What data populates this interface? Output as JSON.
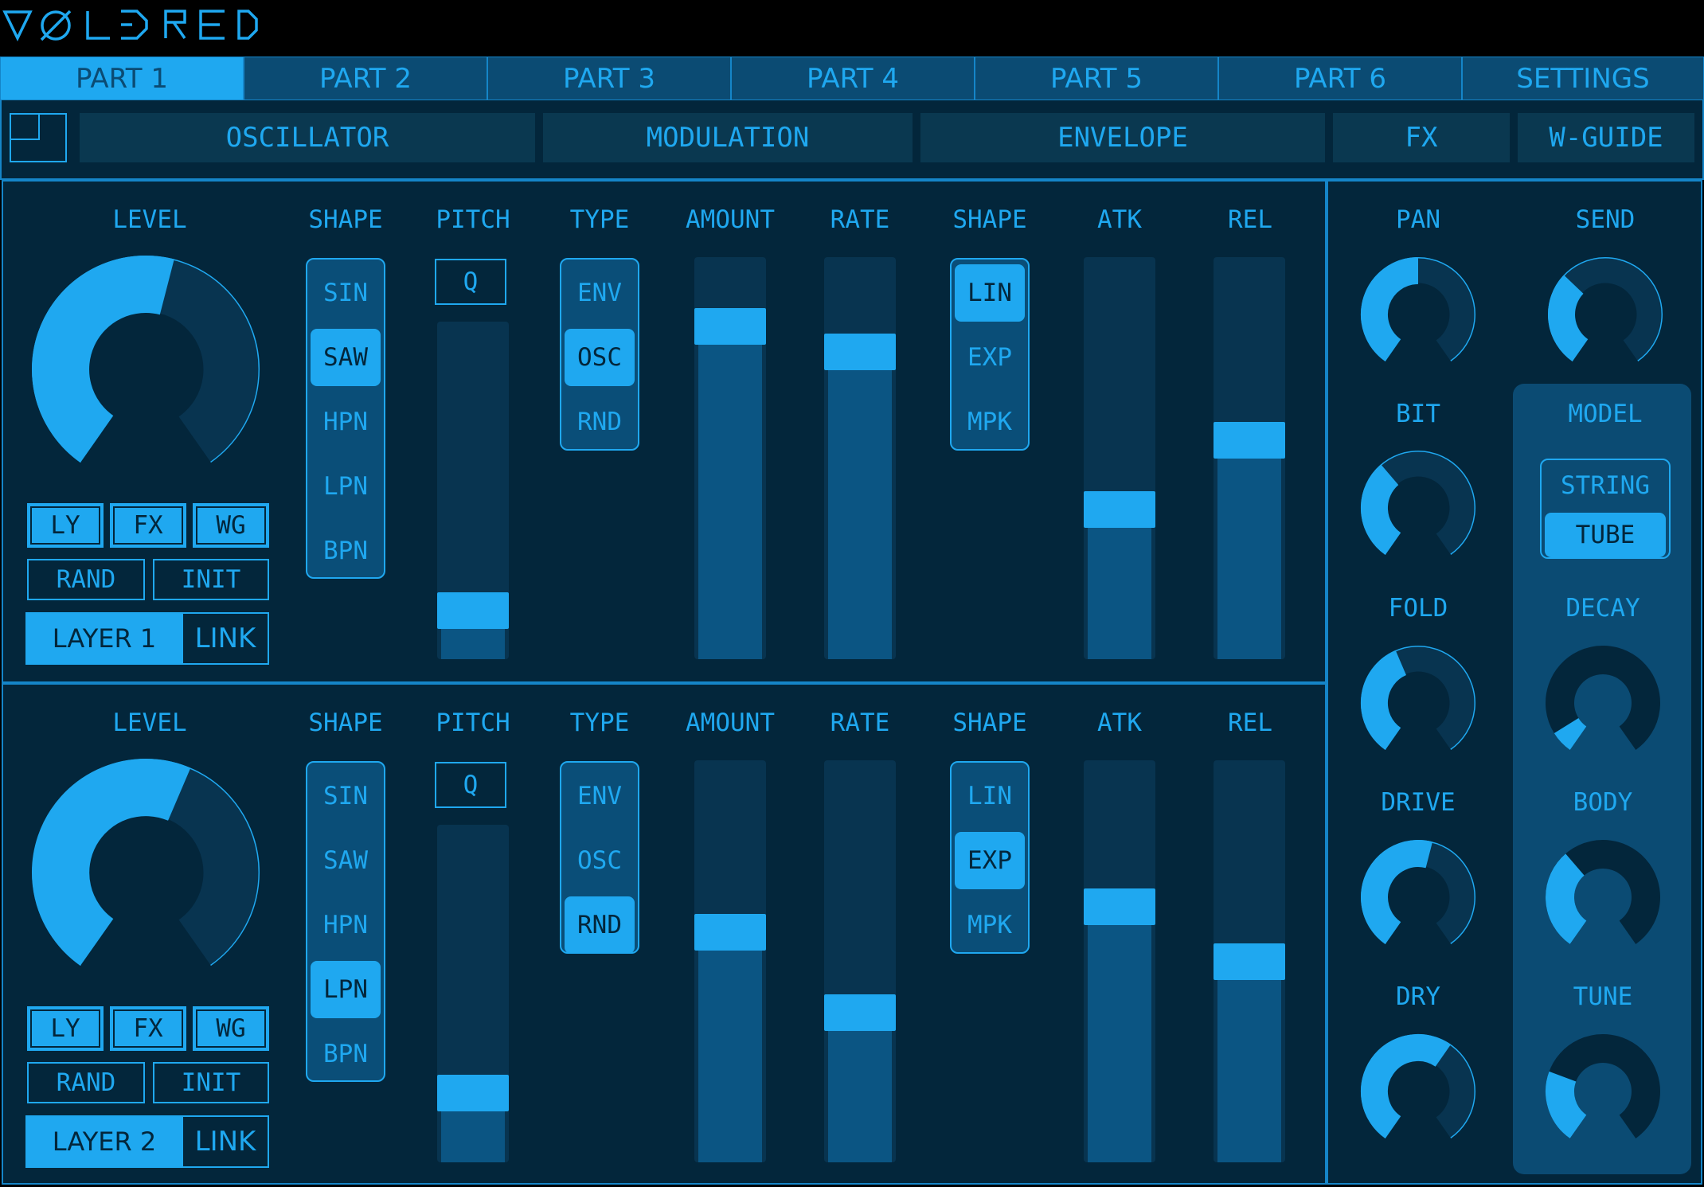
{
  "app": {
    "logo_text": "VØLDRED"
  },
  "part_tabs": [
    {
      "label": "PART 1",
      "active": true
    },
    {
      "label": "PART 2",
      "active": false
    },
    {
      "label": "PART 3",
      "active": false
    },
    {
      "label": "PART 4",
      "active": false
    },
    {
      "label": "PART 5",
      "active": false
    },
    {
      "label": "PART 6",
      "active": false
    },
    {
      "label": "SETTINGS",
      "active": false
    }
  ],
  "section_tabs": [
    "OSCILLATOR",
    "MODULATION",
    "ENVELOPE",
    "FX",
    "W-GUIDE"
  ],
  "layers": [
    {
      "labels": {
        "level": "LEVEL",
        "shape": "SHAPE",
        "pitch": "PITCH",
        "type": "TYPE",
        "amount": "AMOUNT",
        "rate": "RATE",
        "mod_shape": "SHAPE",
        "atk": "ATK",
        "rel": "REL"
      },
      "level": 0.55,
      "shape_options": [
        "SIN",
        "SAW",
        "HPN",
        "LPN",
        "BPN"
      ],
      "shape_selected": "SAW",
      "pitch_q": "Q",
      "pitch": 0.1,
      "type_options": [
        "ENV",
        "OSC",
        "RND"
      ],
      "type_selected": "OSC",
      "amount": 0.86,
      "rate": 0.79,
      "mod_shape_options": [
        "LIN",
        "EXP",
        "MPK"
      ],
      "mod_shape_selected": "LIN",
      "atk": 0.36,
      "rel": 0.55,
      "buttons": {
        "ly": "LY",
        "fx": "FX",
        "wg": "WG",
        "rand": "RAND",
        "init": "INIT"
      },
      "layer_name": "LAYER 1",
      "link": "LINK"
    },
    {
      "labels": {
        "level": "LEVEL",
        "shape": "SHAPE",
        "pitch": "PITCH",
        "type": "TYPE",
        "amount": "AMOUNT",
        "rate": "RATE",
        "mod_shape": "SHAPE",
        "atk": "ATK",
        "rel": "REL"
      },
      "level": 0.58,
      "shape_options": [
        "SIN",
        "SAW",
        "HPN",
        "LPN",
        "BPN"
      ],
      "shape_selected": "LPN",
      "pitch_q": "Q",
      "pitch": 0.17,
      "type_options": [
        "ENV",
        "OSC",
        "RND"
      ],
      "type_selected": "RND",
      "amount": 0.58,
      "rate": 0.36,
      "mod_shape_options": [
        "LIN",
        "EXP",
        "MPK"
      ],
      "mod_shape_selected": "EXP",
      "atk": 0.65,
      "rel": 0.5,
      "buttons": {
        "ly": "LY",
        "fx": "FX",
        "wg": "WG",
        "rand": "RAND",
        "init": "INIT"
      },
      "layer_name": "LAYER 2",
      "link": "LINK"
    }
  ],
  "fx": {
    "pan": {
      "label": "PAN",
      "value": 0.5
    },
    "send": {
      "label": "SEND",
      "value": 0.34
    },
    "bit": {
      "label": "BIT",
      "value": 0.36
    },
    "fold": {
      "label": "FOLD",
      "value": 0.42
    },
    "drive": {
      "label": "DRIVE",
      "value": 0.55
    },
    "dry": {
      "label": "DRY",
      "value": 0.62
    }
  },
  "wguide": {
    "model_label": "MODEL",
    "model_options": [
      "STRING",
      "TUBE"
    ],
    "model_selected": "TUBE",
    "decay": {
      "label": "DECAY",
      "value": 0.08
    },
    "body": {
      "label": "BODY",
      "value": 0.36
    },
    "tune": {
      "label": "TUNE",
      "value": 0.26
    }
  },
  "colors": {
    "accent": "#1fa8f0",
    "panel": "#03263b",
    "mid": "#0b4b73",
    "background": "#000000"
  }
}
